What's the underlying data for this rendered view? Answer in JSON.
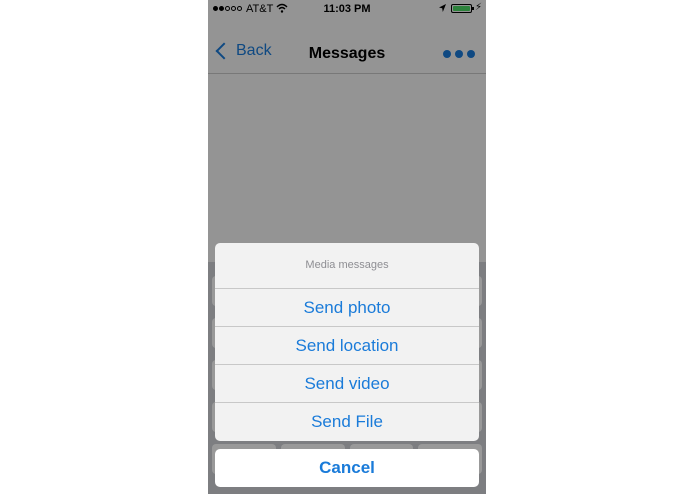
{
  "status_bar": {
    "carrier": "AT&T",
    "time": "11:03 PM",
    "signal_bars_filled": 2,
    "signal_bars_total": 5,
    "wifi_icon": "wifi-icon",
    "location_icon": "location-arrow-icon",
    "battery_icon": "battery-icon",
    "charging_icon": "bolt-icon"
  },
  "nav_bar": {
    "back_label": "Back",
    "title": "Messages",
    "more_icon": "ellipsis-icon"
  },
  "action_sheet": {
    "title": "Media messages",
    "items": [
      {
        "label": "Send photo"
      },
      {
        "label": "Send location"
      },
      {
        "label": "Send video"
      },
      {
        "label": "Send File"
      }
    ],
    "cancel_label": "Cancel"
  },
  "colors": {
    "accent": "#1a7bd9",
    "battery_fill": "#4cd964",
    "sheet_background": "#f2f2f2",
    "overlay": "rgba(0,0,0,0.40)"
  }
}
